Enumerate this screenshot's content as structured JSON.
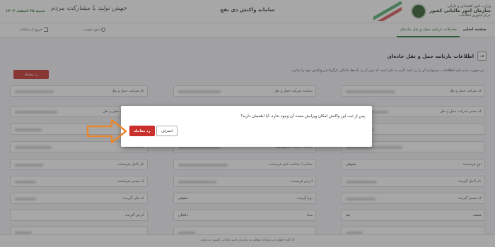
{
  "header": {
    "org_lines": [
      "وزارت امور اقتصادی و دارایی",
      "سازمان امور مالیاتی کشور",
      "مرکز فناوری اطلاعات"
    ],
    "org_main": "سازمان امور مالیاتی کشور",
    "system_title": "سامانه واکنش ذی نفع",
    "calligraphy": "جهش تولید با مشارکت مردم",
    "date": "شنبه ۲۵ اسفند ۱۴۰۳"
  },
  "nav": {
    "home": "صفحه اصلی",
    "active_tab": "معاملات بارنامه حمل و نقل جاده‌ای",
    "user": "بدون هویت",
    "logout": "خروج از سامانه"
  },
  "section": {
    "title": "اطلاعات بارنامه حمل و نقل جاده‌ای",
    "back_icon": "arrow-right-icon",
    "notice": "در صورت عدم تایید اطلاعات، می‌توانید آن را رد کنید. لازم به ذکر است که پس از رد داده‌ها، امکان بازگرداندن واکنش خود را ندارید.",
    "reject_button": "رد معامله"
  },
  "form": {
    "rows": [
      {
        "labels": [
          "کد شرکت حمل و نقل",
          "شناسه شرکت حمل و نقل",
          "نام شرکت حمل و نقل"
        ],
        "values": [
          "",
          "",
          ""
        ]
      },
      {
        "labels": [
          "کد پستی شرکت حمل و نقل",
          "",
          "کد پستی شرکت حمل و نقل"
        ],
        "values": [
          "",
          "",
          ""
        ]
      },
      {
        "labels": [
          "",
          "",
          "وضعیت واکنش"
        ],
        "values": [
          "",
          "",
          ""
        ]
      },
      {
        "labels": [
          "",
          "شماره بارنامه الکترونیکی",
          "سریال بارنامه"
        ],
        "values": [
          "",
          "",
          ""
        ]
      },
      {
        "labels": [
          "نوع فرستنده",
          "شماره / شناسه ملی فرستنده",
          "نام کامل فرستنده"
        ],
        "values": [
          "حقوقی",
          "",
          ""
        ]
      },
      {
        "labels": [
          "نام کامل گیرنده",
          "آدرس فرستنده",
          "کد پستی فرستنده"
        ],
        "values": [
          "",
          "",
          ""
        ]
      },
      {
        "labels": [
          "کد پستی گیرنده",
          "نوع گیرنده",
          "کد ملی گیرنده"
        ],
        "values": [
          "",
          "حقیقی",
          ""
        ]
      },
      {
        "labels": [
          "مقصد",
          "مبدا",
          "آدرس گیرنده"
        ],
        "values": [
          "قم",
          "دلیجان",
          ""
        ]
      },
      {
        "labels": [
          "",
          "",
          ""
        ],
        "values": [
          "",
          "",
          ""
        ]
      }
    ]
  },
  "footer": {
    "text": "© کلیه حقوق این سامانه متعلق به سازمان امور مالیاتی کشور می‌باشد."
  },
  "modal": {
    "message": "پس از ثبت این واکنش امکان ویرایش مجدد آن وجود ندارد، آیا اطمینان دارید؟",
    "cancel": "انصراف",
    "confirm_reject": "رد معامله"
  },
  "colors": {
    "accent_green": "#2e7d32",
    "reject_red": "#c9302c",
    "annotation_arrow": "#e8872d"
  }
}
